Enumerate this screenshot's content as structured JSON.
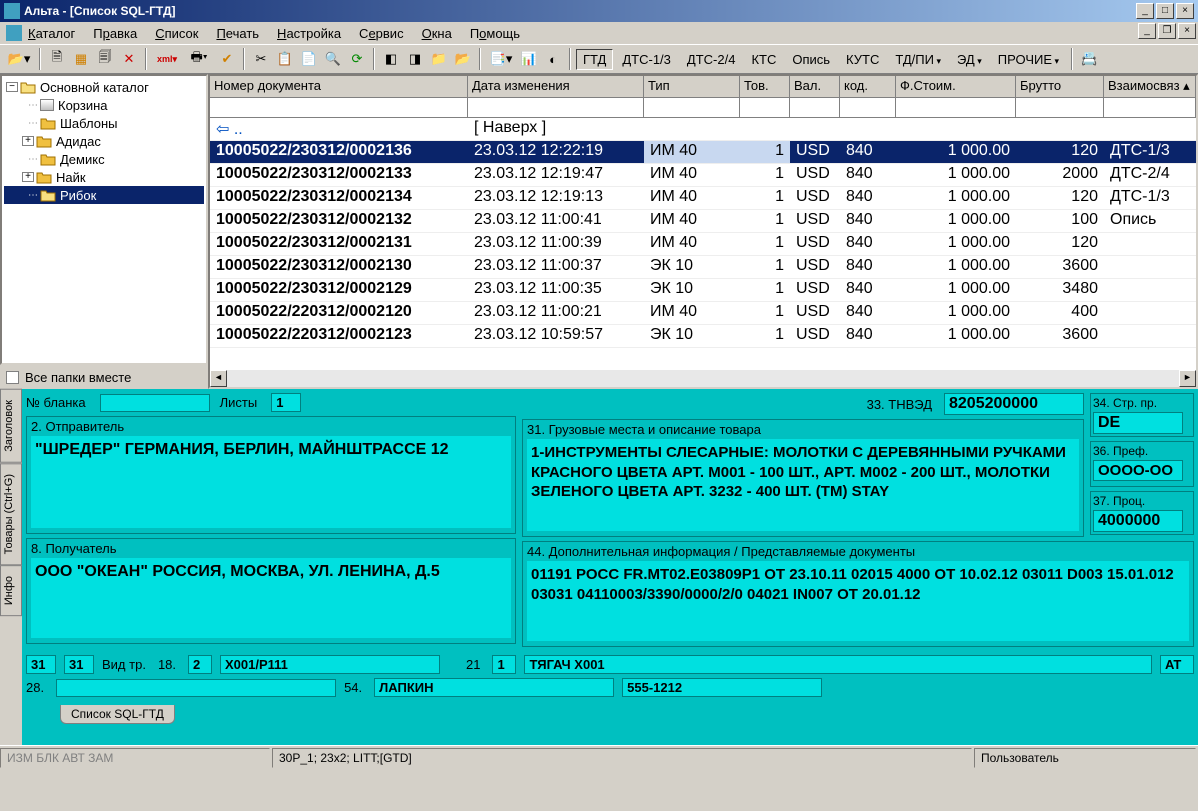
{
  "title": "Альта - [Список SQL-ГТД]",
  "menu": [
    "Каталог",
    "Правка",
    "Список",
    "Печать",
    "Настройка",
    "Сервис",
    "Окна",
    "Помощь"
  ],
  "tabs": [
    "ГТД",
    "ДТС-1/3",
    "ДТС-2/4",
    "КТС",
    "Опись",
    "КУТС",
    "ТД/ПИ",
    "ЭД",
    "ПРОЧИЕ"
  ],
  "tree": {
    "root": "Основной каталог",
    "items": [
      "Корзина",
      "Шаблоны",
      "Адидас",
      "Демикс",
      "Найк",
      "Рибок"
    ]
  },
  "all_folders": "Все папки вместе",
  "grid": {
    "cols": [
      "Номер документа",
      "Дата изменения",
      "Тип",
      "Тов.",
      "Вал.",
      "код.",
      "Ф.Стоим.",
      "Брутто",
      "Взаимосвяз"
    ],
    "up": "[ Наверх ]",
    "rows": [
      {
        "doc": "10005022/230312/0002136",
        "date": "23.03.12 12:22:19",
        "type": "ИМ 40",
        "tov": "1",
        "val": "USD",
        "kod": "840",
        "cost": "1 000.00",
        "gross": "120",
        "rel": "ДТС-1/3",
        "sel": true
      },
      {
        "doc": "10005022/230312/0002133",
        "date": "23.03.12 12:19:47",
        "type": "ИМ 40",
        "tov": "1",
        "val": "USD",
        "kod": "840",
        "cost": "1 000.00",
        "gross": "2000",
        "rel": "ДТС-2/4"
      },
      {
        "doc": "10005022/230312/0002134",
        "date": "23.03.12 12:19:13",
        "type": "ИМ 40",
        "tov": "1",
        "val": "USD",
        "kod": "840",
        "cost": "1 000.00",
        "gross": "120",
        "rel": "ДТС-1/3"
      },
      {
        "doc": "10005022/230312/0002132",
        "date": "23.03.12 11:00:41",
        "type": "ИМ 40",
        "tov": "1",
        "val": "USD",
        "kod": "840",
        "cost": "1 000.00",
        "gross": "100",
        "rel": "Опись"
      },
      {
        "doc": "10005022/230312/0002131",
        "date": "23.03.12 11:00:39",
        "type": "ИМ 40",
        "tov": "1",
        "val": "USD",
        "kod": "840",
        "cost": "1 000.00",
        "gross": "120",
        "rel": ""
      },
      {
        "doc": "10005022/230312/0002130",
        "date": "23.03.12 11:00:37",
        "type": "ЭК 10",
        "tov": "1",
        "val": "USD",
        "kod": "840",
        "cost": "1 000.00",
        "gross": "3600",
        "rel": ""
      },
      {
        "doc": "10005022/230312/0002129",
        "date": "23.03.12 11:00:35",
        "type": "ЭК 10",
        "tov": "1",
        "val": "USD",
        "kod": "840",
        "cost": "1 000.00",
        "gross": "3480",
        "rel": ""
      },
      {
        "doc": "10005022/220312/0002120",
        "date": "23.03.12 11:00:21",
        "type": "ИМ 40",
        "tov": "1",
        "val": "USD",
        "kod": "840",
        "cost": "1 000.00",
        "gross": "400",
        "rel": ""
      },
      {
        "doc": "10005022/220312/0002123",
        "date": "23.03.12 10:59:57",
        "type": "ЭК 10",
        "tov": "1",
        "val": "USD",
        "kod": "840",
        "cost": "1 000.00",
        "gross": "3600",
        "rel": ""
      }
    ]
  },
  "form": {
    "blank_label": "№ бланка",
    "sheets_label": "Листы",
    "sheets": "1",
    "sender_title": "2. Отправитель",
    "sender": "\"ШРЕДЕР\" ГЕРМАНИЯ, БЕРЛИН, МАЙНШТРАССЕ 12",
    "receiver_title": "8. Получатель",
    "receiver": "ООО \"ОКЕАН\" РОССИЯ, МОСКВА, УЛ. ЛЕНИНА, Д.5",
    "goods_title": "31. Грузовые места и описание товара",
    "goods": "1-ИНСТРУМЕНТЫ СЛЕСАРНЫЕ: МОЛОТКИ С ДЕРЕВЯННЫМИ РУЧКАМИ КРАСНОГО ЦВЕТА АРТ. М001 - 100 ШТ., АРТ. М002 - 200 ШТ., МОЛОТКИ ЗЕЛЕНОГО ЦВЕТА АРТ. 3232 - 400 ШТ. (ТМ) STAY",
    "tnved_label": "33. ТНВЭД",
    "tnved": "8205200000",
    "country_label": "34. Стр. пр.",
    "country": "DE",
    "pref_label": "36. Преф.",
    "pref": "ОООО-ОО",
    "proc_label": "37. Проц.",
    "proc": "4000000",
    "docs_title": "44. Дополнительная информация / Представляемые документы",
    "docs": "01191  РОСС FR.МТ02.Е03809Р1 ОТ 23.10.11 02015  4000 ОТ 10.02.12 03011  D003  15.01.012 03031 04110003/3390/0000/2/0 04021  IN007 ОТ 20.01.12",
    "f31a": "31",
    "f31b": "31",
    "vidtr": "Вид тр.",
    "f18": "18.",
    "f18v": "2",
    "cont": "X001/P111",
    "f21": "21",
    "f21v": "1",
    "tugboat": "ТЯГАЧ X001",
    "at": "AT",
    "f28": "28.",
    "f54": "54.",
    "f54v": "ЛАПКИН",
    "phone": "555-1212"
  },
  "vtabs": [
    "Заголовок",
    "Товары (Ctrl+G)",
    "Инфо"
  ],
  "btab": "Список SQL-ГТД",
  "status": {
    "modes": "ИЗМ  БЛК  АВТ  ЗАМ",
    "info": "30P_1; 23x2; LITT;[GTD]",
    "user": "Пользователь"
  }
}
